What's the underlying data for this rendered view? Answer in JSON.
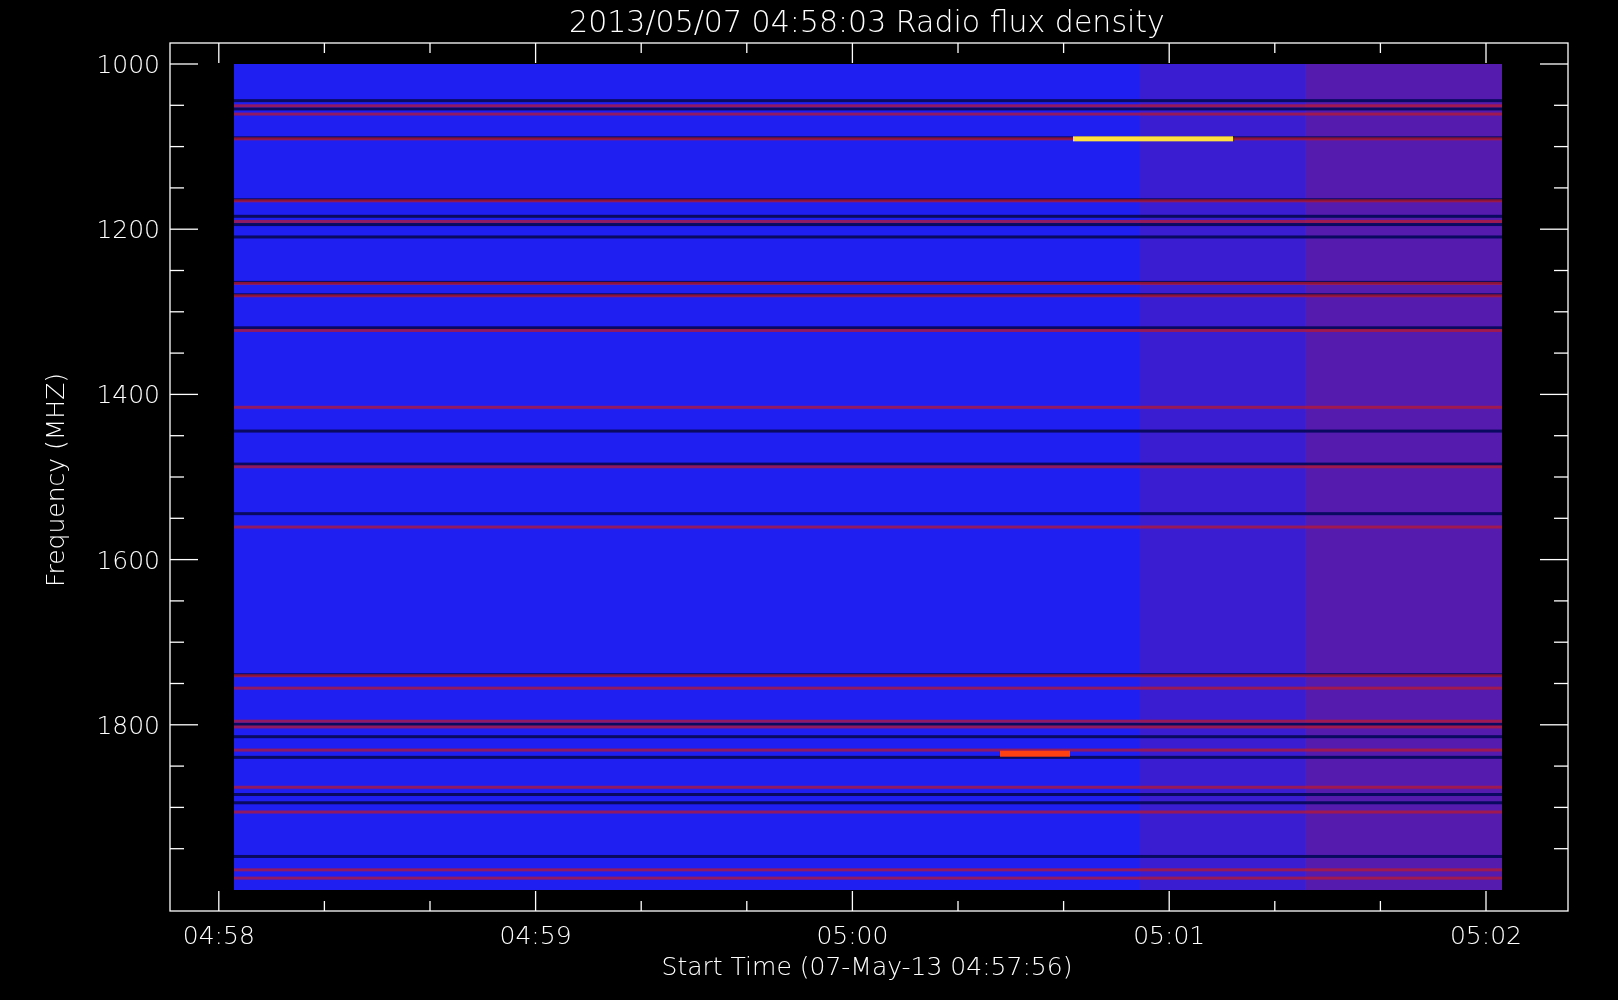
{
  "plot": {
    "title": "2013/05/07 04:58:03 Radio flux density",
    "ylabel": "Frequency (MHZ)",
    "xlabel": "Start Time (07-May-13 04:57:56)",
    "y_tick_labels": [
      "1000",
      "1200",
      "1400",
      "1600",
      "1800"
    ],
    "x_tick_labels": [
      "04:58",
      "04:59",
      "05:00",
      "05:01",
      "05:02"
    ]
  }
}
